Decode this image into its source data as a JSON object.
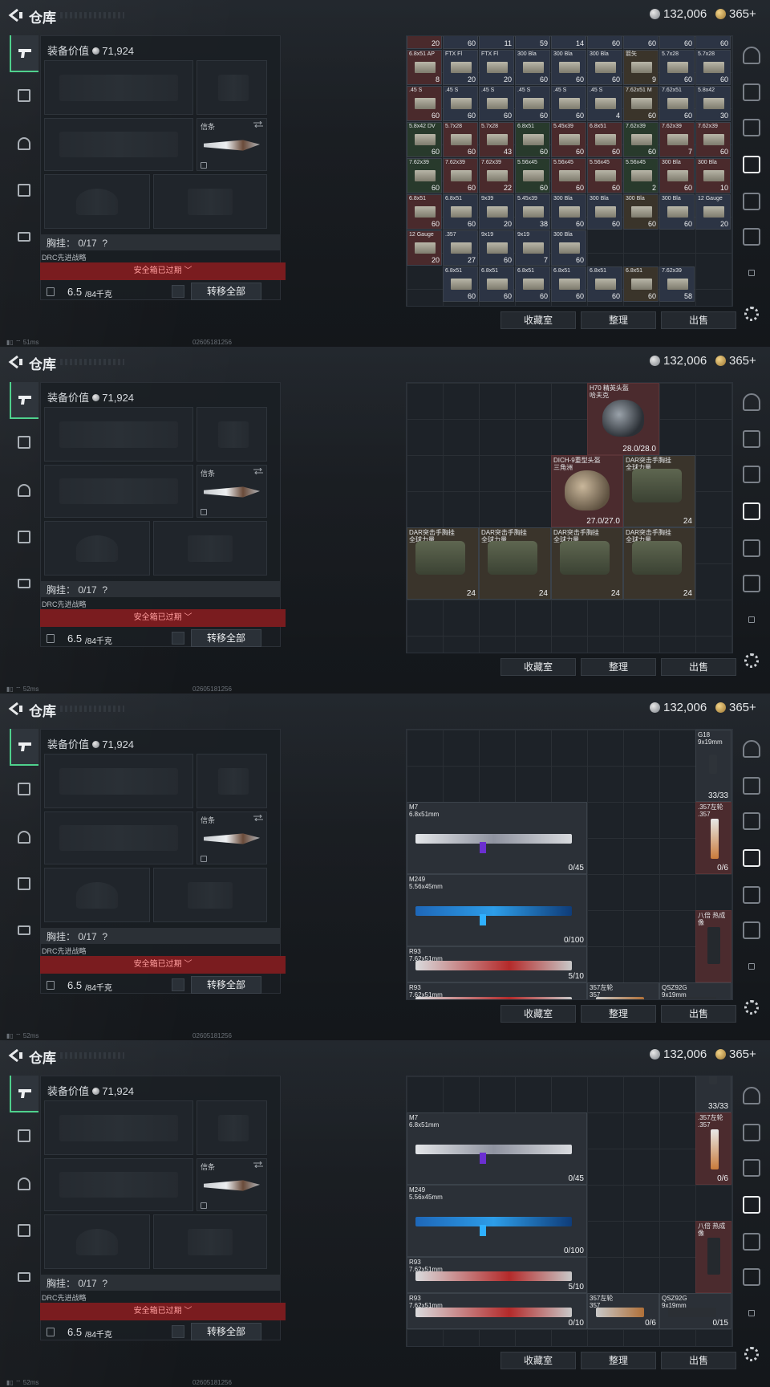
{
  "header": {
    "title": "仓库",
    "silver": "132,006",
    "gold": "365+"
  },
  "left": {
    "equip_value_label": "装备价值",
    "equip_value": "71,924",
    "knife_label": "信条",
    "chest_label": "胸挂：",
    "chest_count": "0/17",
    "chest_help": "?",
    "drc_label": "DRC先进战略",
    "expired_label": "安全箱已过期",
    "weight_value": "6.5",
    "weight_max": "/84千克",
    "transfer_all": "转移全部"
  },
  "buttons": {
    "collection": "收藏室",
    "organize": "整理",
    "sell": "出售"
  },
  "status": {
    "ping": [
      "51ms",
      "52ms",
      "52ms",
      "52ms"
    ],
    "uid": "02605181256"
  },
  "ammo_rows": [
    [
      {
        "n": "6.8x51 AP",
        "c": "8"
      },
      {
        "n": "FTX Fl",
        "c": "20"
      },
      {
        "n": "FTX Fl",
        "c": "20"
      },
      {
        "n": "300 Bla",
        "c": "60"
      },
      {
        "n": "300 Bla",
        "c": "60"
      },
      {
        "n": "300 Bla",
        "c": "60"
      },
      {
        "n": "箭矢",
        "c": "9"
      },
      {
        "n": "5.7x28",
        "c": "60"
      },
      {
        "n": "5.7x28",
        "c": "60"
      }
    ],
    [
      {
        "n": ".45 S",
        "c": "60"
      },
      {
        "n": ".45 S",
        "c": "60"
      },
      {
        "n": ".45 S",
        "c": "60"
      },
      {
        "n": ".45 S",
        "c": "60"
      },
      {
        "n": ".45 S",
        "c": "60"
      },
      {
        "n": ".45 S",
        "c": "4"
      },
      {
        "n": "7.62x51 M",
        "c": "60"
      },
      {
        "n": "7.62x51",
        "c": "60"
      },
      {
        "n": "5.8x42",
        "c": "30"
      }
    ],
    [
      {
        "n": "5.8x42 DV",
        "c": "60"
      },
      {
        "n": "5.7x28",
        "c": "60"
      },
      {
        "n": "5.7x28",
        "c": "43"
      },
      {
        "n": "6.8x51",
        "c": "60"
      },
      {
        "n": "5.45x39",
        "c": "60"
      },
      {
        "n": "6.8x51",
        "c": "60"
      },
      {
        "n": "7.62x39",
        "c": "60"
      },
      {
        "n": "7.62x39",
        "c": "7"
      },
      {
        "n": "7.62x39",
        "c": "60"
      }
    ],
    [
      {
        "n": "7.62x39",
        "c": "60"
      },
      {
        "n": "7.62x39",
        "c": "60"
      },
      {
        "n": "7.62x39",
        "c": "22"
      },
      {
        "n": "5.56x45",
        "c": "60"
      },
      {
        "n": "5.56x45",
        "c": "60"
      },
      {
        "n": "5.56x45",
        "c": "60"
      },
      {
        "n": "5.56x45",
        "c": "2"
      },
      {
        "n": "300 Bla",
        "c": "60"
      },
      {
        "n": "300 Bla",
        "c": "10"
      }
    ],
    [
      {
        "n": "6.8x51",
        "c": "60"
      },
      {
        "n": "6.8x51",
        "c": "60"
      },
      {
        "n": "9x39",
        "c": "20"
      },
      {
        "n": "5.45x39",
        "c": "38"
      },
      {
        "n": "300 Bla",
        "c": "60"
      },
      {
        "n": "300 Bla",
        "c": "60"
      },
      {
        "n": "300 Bla",
        "c": "60"
      },
      {
        "n": "300 Bla",
        "c": "60"
      },
      {
        "n": "12 Gauge",
        "c": "20"
      }
    ],
    [
      {
        "n": "12 Gauge",
        "c": "20"
      },
      {
        "n": ".357",
        "c": "27"
      },
      {
        "n": "9x19",
        "c": "60"
      },
      {
        "n": "9x19",
        "c": "7"
      },
      {
        "n": "300 Bla",
        "c": "60"
      }
    ],
    [
      {
        "n": "6.8x51",
        "c": "60"
      },
      {
        "n": "6.8x51",
        "c": "60"
      },
      {
        "n": "6.8x51",
        "c": "60"
      },
      {
        "n": "6.8x51",
        "c": "60"
      },
      {
        "n": "6.8x51",
        "c": "60"
      },
      {
        "n": "6.8x51",
        "c": "60"
      },
      {
        "n": "7.62x39",
        "c": "58"
      }
    ]
  ],
  "ammo_top": [
    "20",
    "60",
    "11",
    "59",
    "14",
    "60",
    "60",
    "60",
    "60"
  ],
  "gear_items": {
    "h70": {
      "name": "H70 精英头盔",
      "sub": "哈夫克",
      "dur": "28.0/28.0"
    },
    "dich": {
      "name": "DICH-9重型头盔",
      "sub": "三角洲",
      "dur": "27.0/27.0"
    },
    "dar": {
      "name": "DAR突击手胸挂",
      "sub": "全球力量",
      "cap": "24"
    }
  },
  "weapons": {
    "g18": {
      "name": "G18",
      "cal": "9x19mm",
      "ammo": "33/33"
    },
    "m7": {
      "name": "M7",
      "cal": "6.8x51mm",
      "ammo": "0/45"
    },
    "r357": {
      "name": ".357左轮",
      "cal": ".357",
      "ammo": "0/6"
    },
    "m249": {
      "name": "M249",
      "cal": "5.56x45mm",
      "ammo": "0/100"
    },
    "scope": {
      "name": "八倍 热成像"
    },
    "r93a": {
      "name": "R93",
      "cal": "7.62x51mm",
      "ammo": "5/10"
    },
    "r93b": {
      "name": "R93",
      "cal": "7.62x51mm",
      "ammo": "0/10"
    },
    "r357b": {
      "name": "357左轮",
      "cal": "357",
      "ammo": "0/6"
    },
    "qsz": {
      "name": "QSZ92G",
      "cal": "9x19mm",
      "ammo": "0/15"
    }
  },
  "colors": {
    "accent_green": "#4fd18d",
    "expired_red": "#7a1c1f",
    "item_red": "#4b2b2e"
  }
}
